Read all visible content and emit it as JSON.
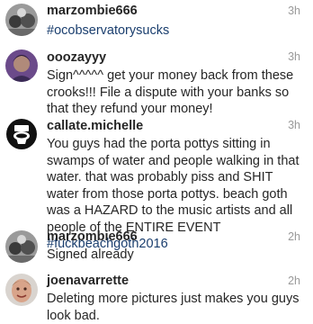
{
  "comments": [
    {
      "username": "marzombie666",
      "time": "3h",
      "text_parts": [
        {
          "text": "#ocobservatorysucks",
          "tag": true
        }
      ],
      "avatar": "zombie-avatar"
    },
    {
      "username": "ooozayyy",
      "time": "3h",
      "text_parts": [
        {
          "text": "Sign^^^^^ get your money back from these crooks!!! File a dispute with your banks so that they refund your money!",
          "tag": false
        }
      ],
      "avatar": "purple-avatar"
    },
    {
      "username": "callate.michelle",
      "time": "3h",
      "text_parts": [
        {
          "text": "You guys had the porta pottys sitting in swamps of water and people walking in that water. that was probably piss and SHIT water from those porta pottys. beach goth was a HAZARD to the music artists and all people of the ENTIRE EVENT ",
          "tag": false
        },
        {
          "text": "#fuckbeachgoth2016",
          "tag": true
        }
      ],
      "avatar": "toilet-avatar"
    },
    {
      "username": "marzombie666",
      "time": "2h",
      "text_parts": [
        {
          "text": "Signed already",
          "tag": false
        }
      ],
      "avatar": "zombie-avatar"
    },
    {
      "username": "joenavarrette",
      "time": "2h",
      "text_parts": [
        {
          "text": "Deleting more pictures just makes you guys look bad.",
          "tag": false
        }
      ],
      "avatar": "face-avatar"
    }
  ],
  "colors": {
    "username": "#262626",
    "time": "#999999",
    "hashtag": "#1a3e6e"
  }
}
